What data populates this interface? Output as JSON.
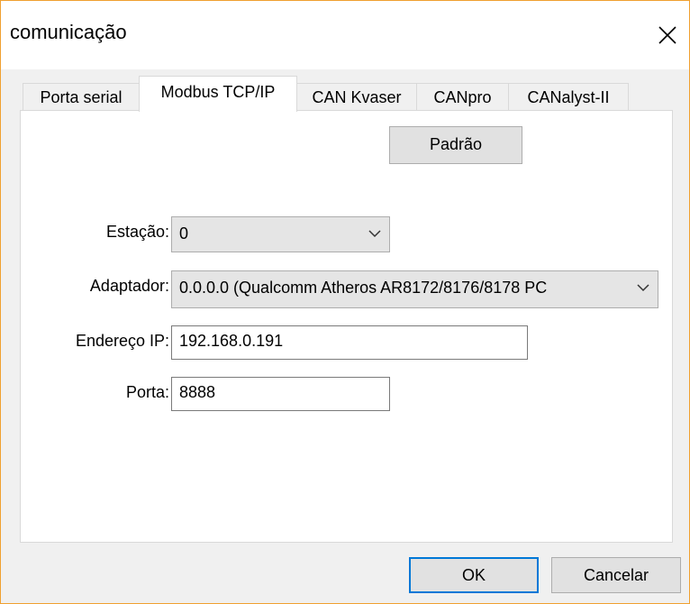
{
  "window": {
    "title": "comunicação"
  },
  "tabs": [
    {
      "label": "Porta serial",
      "active": false
    },
    {
      "label": "Modbus TCP/IP",
      "active": true
    },
    {
      "label": "CAN Kvaser",
      "active": false
    },
    {
      "label": "CANpro",
      "active": false
    },
    {
      "label": "CANalyst-II",
      "active": false
    }
  ],
  "form": {
    "padrao_label": "Padrão",
    "estacao": {
      "label": "Estação:",
      "value": "0"
    },
    "adaptador": {
      "label": "Adaptador:",
      "value": "0.0.0.0 (Qualcomm Atheros AR8172/8176/8178 PC"
    },
    "endereco_ip": {
      "label": "Endereço IP:",
      "value": "192.168.0.191"
    },
    "porta": {
      "label": "Porta:",
      "value": "8888"
    }
  },
  "buttons": {
    "ok": "OK",
    "cancelar": "Cancelar"
  },
  "icons": {
    "close": "close-icon",
    "dropdown": "chevron-down-icon"
  },
  "colors": {
    "window_border": "#f0a030",
    "default_button_border": "#0078d7"
  }
}
